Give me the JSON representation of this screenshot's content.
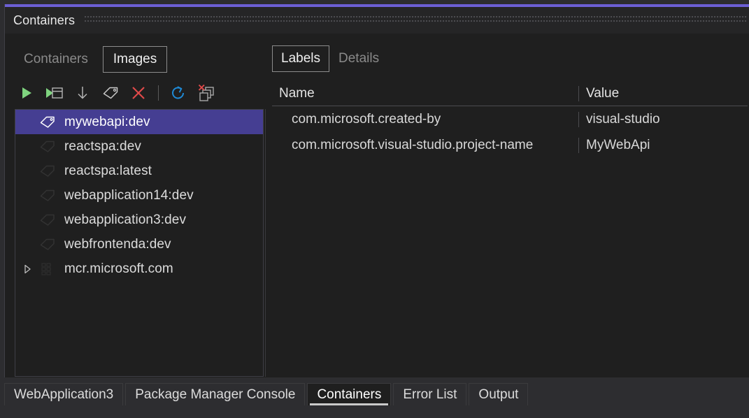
{
  "window": {
    "title": "Containers",
    "accent_color": "#6c5fd4",
    "background_color": "#1f1f1f",
    "drag_handle": "drag-dots"
  },
  "subtabs": [
    {
      "label": "Containers",
      "selected": false
    },
    {
      "label": "Images",
      "selected": true
    }
  ],
  "toolbar": {
    "buttons": [
      {
        "name": "run-icon",
        "tooltip": "Run"
      },
      {
        "name": "run-interactive-icon",
        "tooltip": "Run Interactive"
      },
      {
        "name": "pull-icon",
        "tooltip": "Pull"
      },
      {
        "name": "tag-icon",
        "tooltip": "Tag"
      },
      {
        "name": "remove-icon",
        "tooltip": "Remove"
      },
      {
        "name": "separator",
        "tooltip": ""
      },
      {
        "name": "refresh-icon",
        "tooltip": "Refresh"
      },
      {
        "name": "prune-images-icon",
        "tooltip": "Prune Images"
      }
    ],
    "colors": {
      "run": "#7fd47f",
      "remove": "#e04a4a",
      "refresh": "#1f8ad6",
      "neutral": "#b4b4b4"
    }
  },
  "tree": {
    "selected_color": "#453e92",
    "items": [
      {
        "label": "mywebapi:dev",
        "icon": "tag-icon",
        "selected": true,
        "expandable": false
      },
      {
        "label": "reactspa:dev",
        "icon": "tag-icon",
        "selected": false,
        "expandable": false
      },
      {
        "label": "reactspa:latest",
        "icon": "tag-icon",
        "selected": false,
        "expandable": false
      },
      {
        "label": "webapplication14:dev",
        "icon": "tag-icon",
        "selected": false,
        "expandable": false
      },
      {
        "label": "webapplication3:dev",
        "icon": "tag-icon",
        "selected": false,
        "expandable": false
      },
      {
        "label": "webfrontenda:dev",
        "icon": "tag-icon",
        "selected": false,
        "expandable": false
      },
      {
        "label": "mcr.microsoft.com",
        "icon": "registry-icon",
        "selected": false,
        "expandable": true
      }
    ]
  },
  "details": {
    "tabs": [
      {
        "label": "Labels",
        "selected": true
      },
      {
        "label": "Details",
        "selected": false
      }
    ],
    "columns": [
      {
        "label": "Name"
      },
      {
        "label": "Value"
      }
    ],
    "rows": [
      {
        "name": "com.microsoft.created-by",
        "value": "visual-studio"
      },
      {
        "name": "com.microsoft.visual-studio.project-name",
        "value": "MyWebApi"
      }
    ]
  },
  "dock_tabs": [
    {
      "label": "WebApplication3",
      "active": false
    },
    {
      "label": "Package Manager Console",
      "active": false
    },
    {
      "label": "Containers",
      "active": true
    },
    {
      "label": "Error List",
      "active": false
    },
    {
      "label": "Output",
      "active": false
    }
  ]
}
